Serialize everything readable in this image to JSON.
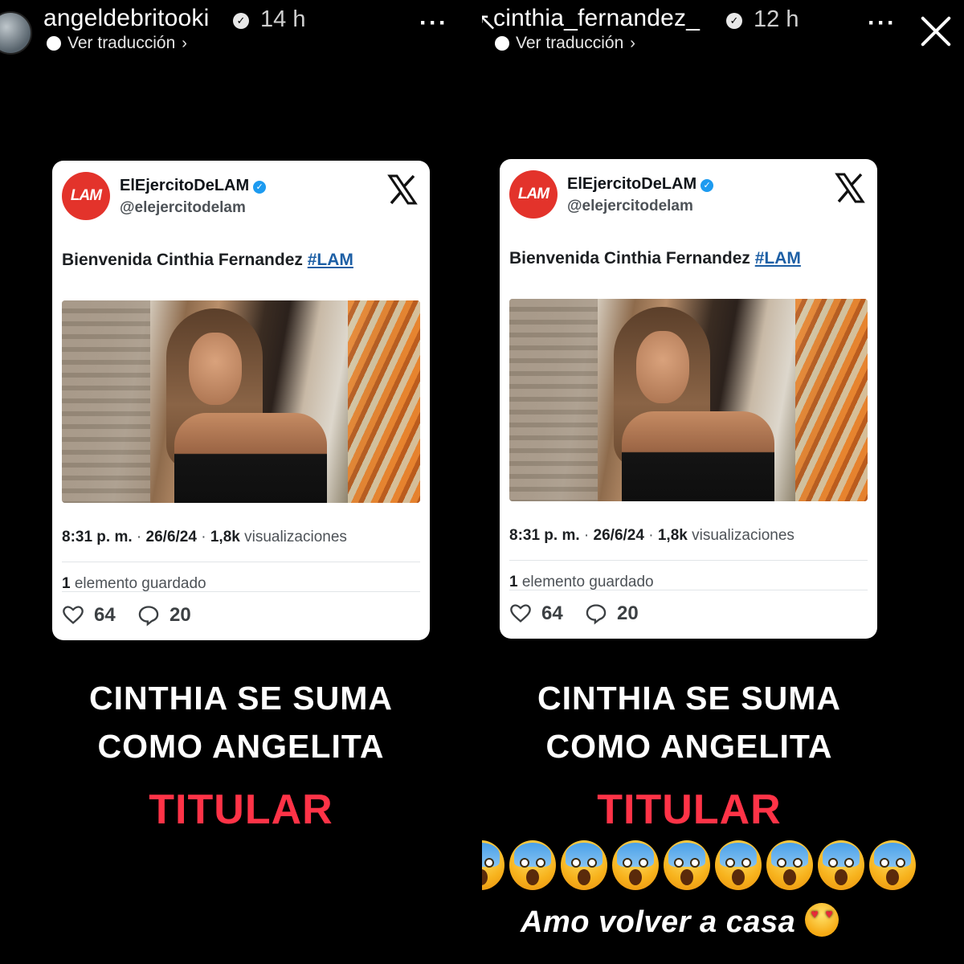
{
  "stories": [
    {
      "username": "angeldebritooki",
      "time": "14 h",
      "translate": "Ver traducción",
      "tweet": {
        "name": "ElEjercitoDeLAM",
        "handle": "@elejercitodelam",
        "logo_text": "LAM",
        "text": "Bienvenida Cinthia Fernandez",
        "hashtag": "#LAM",
        "time": "8:31 p. m.",
        "date": "26/6/24",
        "views_count": "1,8k",
        "views_label": "visualizaciones",
        "saved_count": "1",
        "saved_label": "elemento guardado",
        "likes": "64",
        "replies": "20"
      },
      "caption_line1": "CINTHIA SE SUMA",
      "caption_line2": "COMO ANGELITA",
      "caption_highlight": "TITULAR"
    },
    {
      "username": "cinthia_fernandez_",
      "time": "12 h",
      "translate": "Ver traducción",
      "tweet": {
        "name": "ElEjercitoDeLAM",
        "handle": "@elejercitodelam",
        "logo_text": "LAM",
        "text": "Bienvenida Cinthia Fernandez",
        "hashtag": "#LAM",
        "time": "8:31 p. m.",
        "date": "26/6/24",
        "views_count": "1,8k",
        "views_label": "visualizaciones",
        "saved_count": "1",
        "saved_label": "elemento guardado",
        "likes": "64",
        "replies": "20"
      },
      "caption_line1": "CINTHIA SE SUMA",
      "caption_line2": "COMO ANGELITA",
      "caption_highlight": "TITULAR",
      "emoji_name": "face-screaming-in-fear",
      "footer_text": "Amo volver a casa"
    }
  ],
  "icons": {
    "more": "more-options-icon",
    "close": "close-icon",
    "like": "heart-icon",
    "reply": "comment-icon",
    "platform": "x-logo-icon"
  },
  "colors": {
    "background": "#000000",
    "highlight": "#ff3347",
    "lam_red": "#e3332b",
    "link_blue": "#1d5fa5",
    "verified_blue": "#1d9bf0"
  }
}
